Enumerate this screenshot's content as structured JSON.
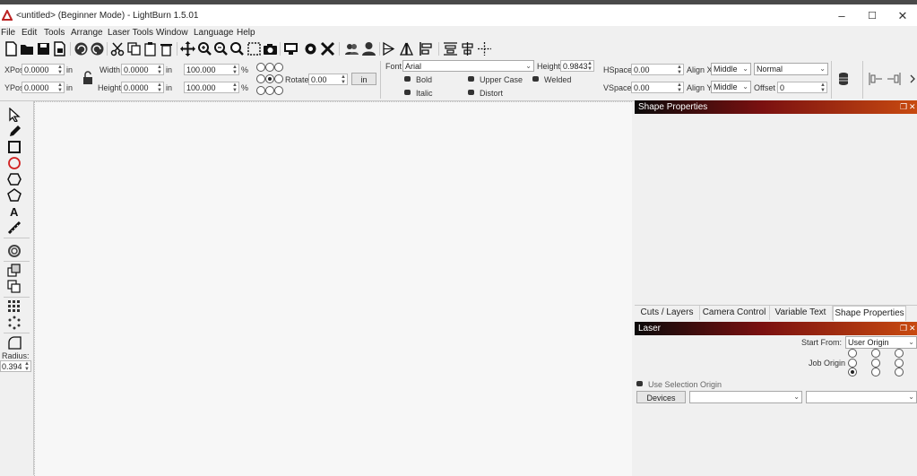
{
  "window": {
    "title": "<untitled> (Beginner Mode) - LightBurn 1.5.01",
    "minimize": "–",
    "maximize": "☐",
    "close": "✕"
  },
  "menu": [
    "File",
    "Edit",
    "Tools",
    "Arrange",
    "Laser Tools",
    "Window",
    "Language",
    "Help"
  ],
  "toolbar1_icons": [
    "new-file-icon",
    "open-file-icon",
    "save-icon",
    "save-as-icon",
    "undo-icon",
    "redo-icon",
    "cut-icon",
    "copy-icon",
    "paste-icon",
    "delete-icon",
    "move-icon",
    "zoom-in-icon",
    "zoom-out-icon",
    "zoom-fit-icon",
    "select-frame-icon",
    "camera-icon",
    "monitor-icon",
    "settings-icon",
    "tools-icon",
    "users-icon",
    "user-icon",
    "mirror-h-icon",
    "mirror-v-icon",
    "align-left-icon",
    "distribute-icon",
    "center-icon"
  ],
  "numeric": {
    "xpos_label": "XPos",
    "xpos": "0.0000",
    "ypos_label": "YPos",
    "ypos": "0.0000",
    "unit": "in",
    "width_label": "Width",
    "width": "0.0000",
    "height_label": "Height",
    "height": "0.0000",
    "pct_w": "100.000",
    "pct_h": "100.000",
    "pct": "%",
    "rotate_label": "Rotate",
    "rotate": "0.00",
    "unit_btn": "in"
  },
  "text_tools": {
    "font_label": "Font",
    "font": "Arial",
    "height_label": "Height",
    "height": "0.9843",
    "bold": "Bold",
    "italic": "Italic",
    "upper": "Upper Case",
    "distort": "Distort",
    "welded": "Welded",
    "hspace_label": "HSpace",
    "hspace": "0.00",
    "vspace_label": "VSpace",
    "vspace": "0.00",
    "alignx_label": "Align X",
    "alignx": "Middle",
    "aligny_label": "Align Y",
    "aligny": "Middle",
    "mode": "Normal",
    "offset_label": "Offset",
    "offset": "0"
  },
  "left_tools": [
    "select-arrow-icon",
    "pen-icon",
    "rectangle-icon",
    "ellipse-icon",
    "polygon-icon",
    "pentagon-icon",
    "text-tool-icon",
    "measure-icon",
    "offset-icon",
    "array-icon",
    "grid-array-icon",
    "circular-array-icon",
    "corner-radius-icon"
  ],
  "radius": {
    "label": "Radius:",
    "value": "0.394"
  },
  "shape_panel": {
    "title": "Shape Properties"
  },
  "tabs": [
    "Cuts / Layers",
    "Camera Control",
    "Variable Text",
    "Shape Properties"
  ],
  "laser": {
    "title": "Laser",
    "start_from_label": "Start From:",
    "start_from": "User Origin",
    "job_origin_label": "Job Origin",
    "use_selection": "Use Selection Origin",
    "devices": "Devices",
    "device_select": "",
    "port_select": ""
  }
}
